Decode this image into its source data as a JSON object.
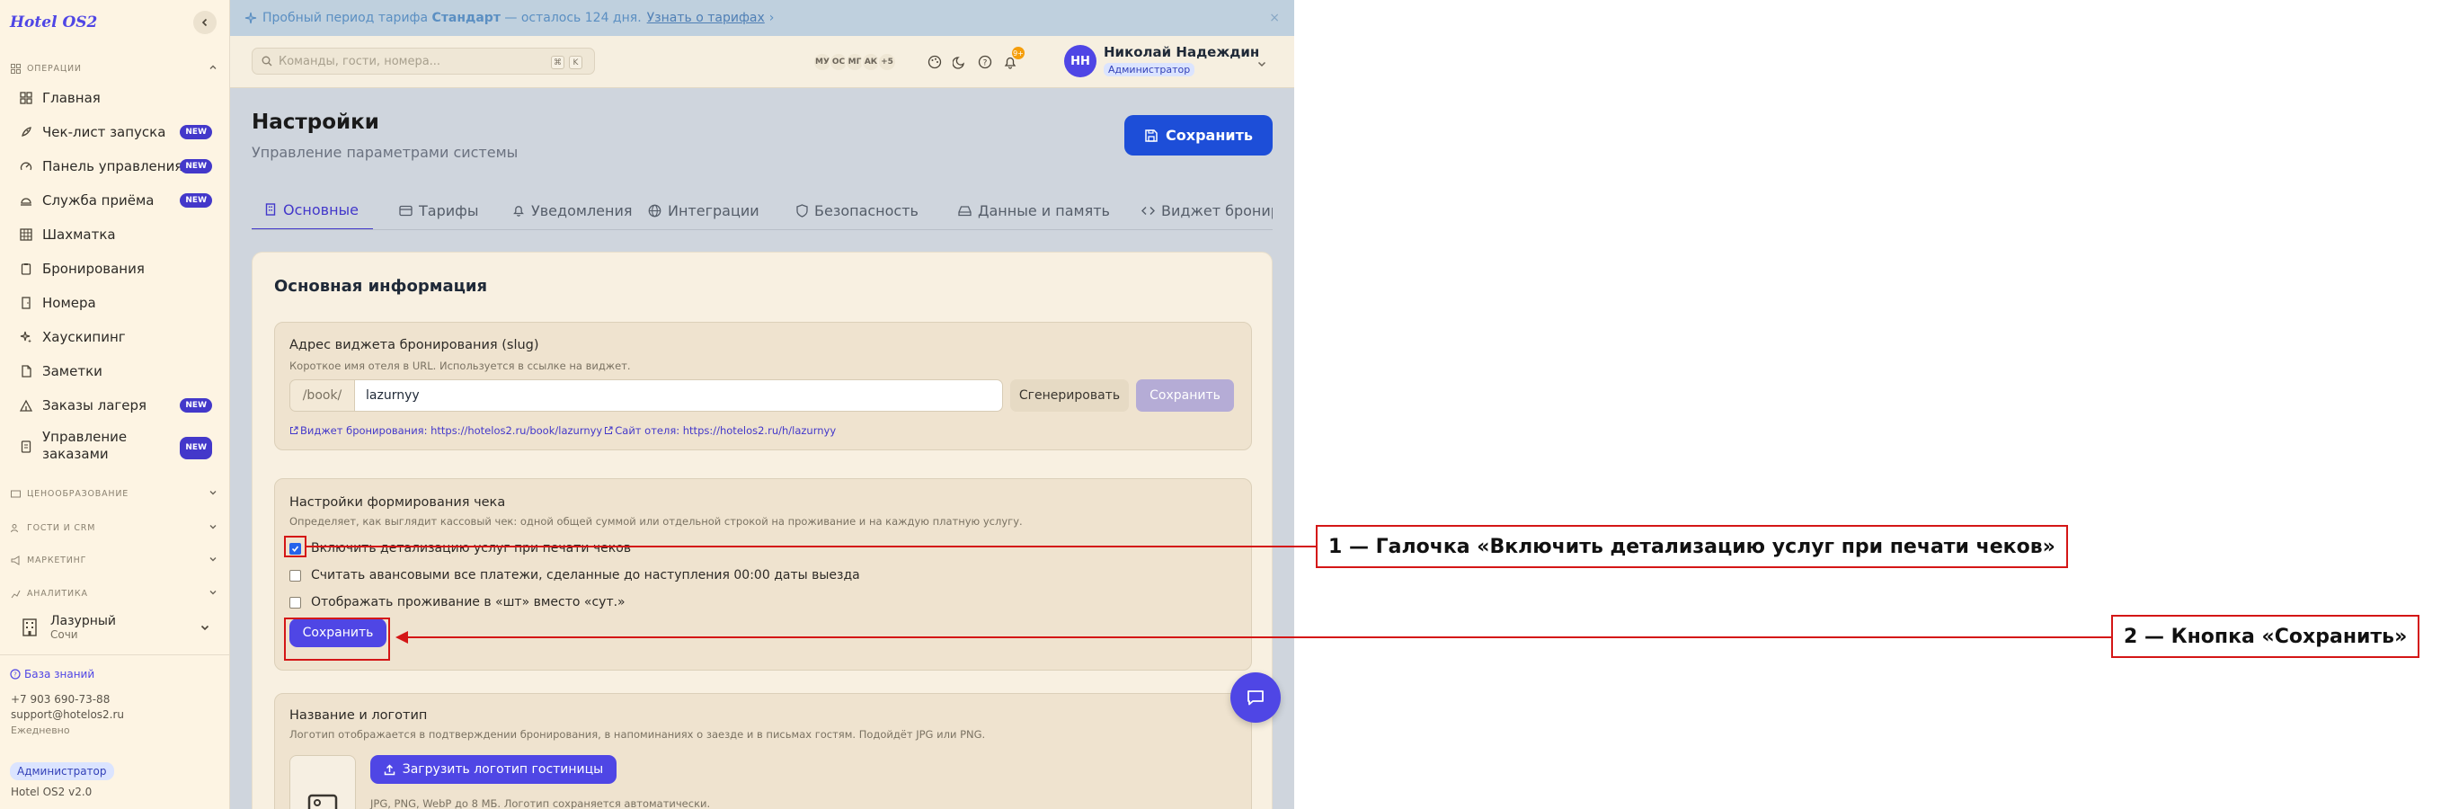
{
  "app": {
    "logo": "Hotel OS2",
    "version": "Hotel OS2 v2.0"
  },
  "sidebar": {
    "section_operations": "ОПЕРАЦИИ",
    "items": [
      {
        "label": "Главная",
        "icon": "dashboard-icon",
        "badge": ""
      },
      {
        "label": "Чек-лист запуска",
        "icon": "rocket-icon",
        "badge": "NEW"
      },
      {
        "label": "Панель управления",
        "icon": "gauge-icon",
        "badge": "NEW"
      },
      {
        "label": "Служба приёма",
        "icon": "bell-service-icon",
        "badge": "NEW"
      },
      {
        "label": "Шахматка",
        "icon": "grid-icon",
        "badge": ""
      },
      {
        "label": "Бронирования",
        "icon": "clipboard-icon",
        "badge": ""
      },
      {
        "label": "Номера",
        "icon": "door-icon",
        "badge": ""
      },
      {
        "label": "Хаускипинг",
        "icon": "sparkles-icon",
        "badge": ""
      },
      {
        "label": "Заметки",
        "icon": "note-icon",
        "badge": ""
      },
      {
        "label": "Заказы лагеря",
        "icon": "tent-icon",
        "badge": "NEW"
      },
      {
        "label": "Управление заказами",
        "icon": "orders-icon",
        "badge": "NEW"
      }
    ],
    "sections": [
      "ЦЕНООБРАЗОВАНИЕ",
      "ГОСТИ И CRM",
      "МАРКЕТИНГ",
      "АНАЛИТИКА"
    ],
    "hotel": {
      "name": "Лазурный",
      "city": "Сочи"
    },
    "footer": {
      "knowledge_base": "База знаний",
      "phone": "+7 903 690-73-88",
      "email": "support@hotelos2.ru",
      "hours": "Ежедневно",
      "role": "Администратор"
    }
  },
  "banner": {
    "prefix": "Пробный период тарифа ",
    "plan": "Стандарт",
    "suffix": " — осталось 124 дня.",
    "link": "Узнать о тарифах",
    "link_arrow": "›",
    "close": "×"
  },
  "topbar": {
    "search_placeholder": "Команды, гости, номера...",
    "kbd_1": "⌘",
    "kbd_2": "K",
    "online_users": [
      "МУ",
      "ОС",
      "МГ",
      "АК",
      "+5"
    ],
    "notifications_count": "9+",
    "user": {
      "initials": "НН",
      "name": "Николай Надеждин",
      "role": "Администратор"
    }
  },
  "page": {
    "title": "Настройки",
    "subtitle": "Управление параметрами системы",
    "save_label": "Сохранить"
  },
  "tabs": [
    {
      "label": "Основные",
      "icon": "building-icon"
    },
    {
      "label": "Тарифы",
      "icon": "credit-card-icon"
    },
    {
      "label": "Уведомления",
      "icon": "bell-icon"
    },
    {
      "label": "Интеграции",
      "icon": "globe-icon"
    },
    {
      "label": "Безопасность",
      "icon": "shield-icon"
    },
    {
      "label": "Данные и память",
      "icon": "hard-drive-icon"
    },
    {
      "label": "Виджет бронирова",
      "icon": "code-icon"
    }
  ],
  "card": {
    "title": "Основная информация",
    "slug": {
      "title": "Адрес виджета бронирования (slug)",
      "description": "Короткое имя отеля в URL. Используется в ссылке на виджет.",
      "prefix": "/book/",
      "value": "lazurnyy",
      "generate": "Сгенерировать",
      "save": "Сохранить",
      "widget_link": "Виджет бронирования: https://hotelos2.ru/book/lazurnyy",
      "hotel_link": "Сайт отеля: https://hotelos2.ru/h/lazurnyy"
    },
    "receipt": {
      "title": "Настройки формирования чека",
      "description": "Определяет, как выглядит кассовый чек: одной общей суммой или отдельной строкой на проживание и на каждую платную услугу.",
      "options": [
        {
          "label": "Включить детализацию услуг при печати чеков",
          "checked": true
        },
        {
          "label": "Считать авансовыми все платежи, сделанные до наступления 00:00 даты выезда",
          "checked": false
        },
        {
          "label": "Отображать проживание в «шт» вместо «сут.»",
          "checked": false
        }
      ],
      "save": "Сохранить"
    },
    "logo": {
      "title": "Название и логотип",
      "description": "Логотип отображается в подтверждении бронирования, в напоминаниях о заезде и в письмах гостям. Подойдёт JPG или PNG.",
      "upload": "Загрузить логотип гостиницы",
      "hint": "JPG, PNG, WebP до 8 МБ. Логотип сохраняется автоматически."
    }
  },
  "annotations": [
    {
      "label": "1 — Галочка «Включить детализацию услуг при печати чеков»"
    },
    {
      "label": "2 — Кнопка «Сохранить»"
    }
  ],
  "colors": {
    "accent": "#4f46e5",
    "primary_button": "#1d4ed8",
    "annotation": "#d41616",
    "sidebar_bg": "#fdf4e3"
  }
}
